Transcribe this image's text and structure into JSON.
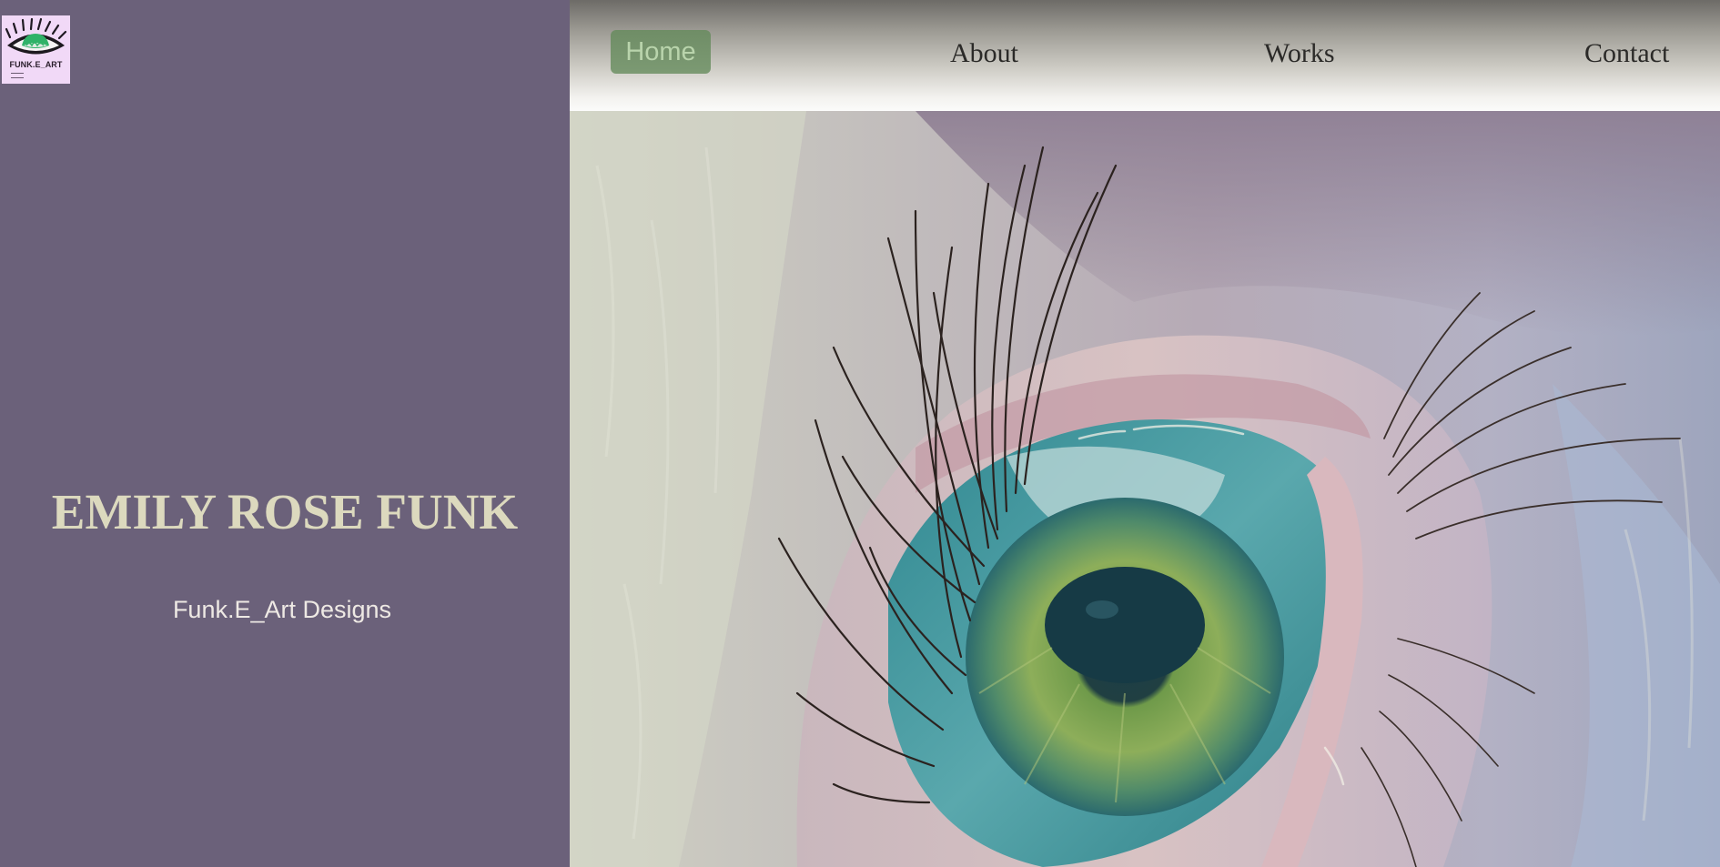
{
  "logo": {
    "text": "FUNK.E_ART",
    "icon": "eye-logo-icon"
  },
  "sidebar": {
    "artist_name": "EMILY ROSE FUNK",
    "tagline": "Funk.E_Art Designs"
  },
  "nav": {
    "items": [
      {
        "label": "Home",
        "active": true
      },
      {
        "label": "About",
        "active": false
      },
      {
        "label": "Works",
        "active": false
      },
      {
        "label": "Contact",
        "active": false
      }
    ]
  },
  "hero": {
    "subject": "eye-painting"
  },
  "colors": {
    "sidebar_bg": "#6b617a",
    "name_color": "#dcd9be",
    "tagline_color": "#eee9e4",
    "nav_active_bg": "#7c9a73",
    "nav_active_text": "#b9d4ac",
    "logo_bg": "#f1d9f7"
  }
}
